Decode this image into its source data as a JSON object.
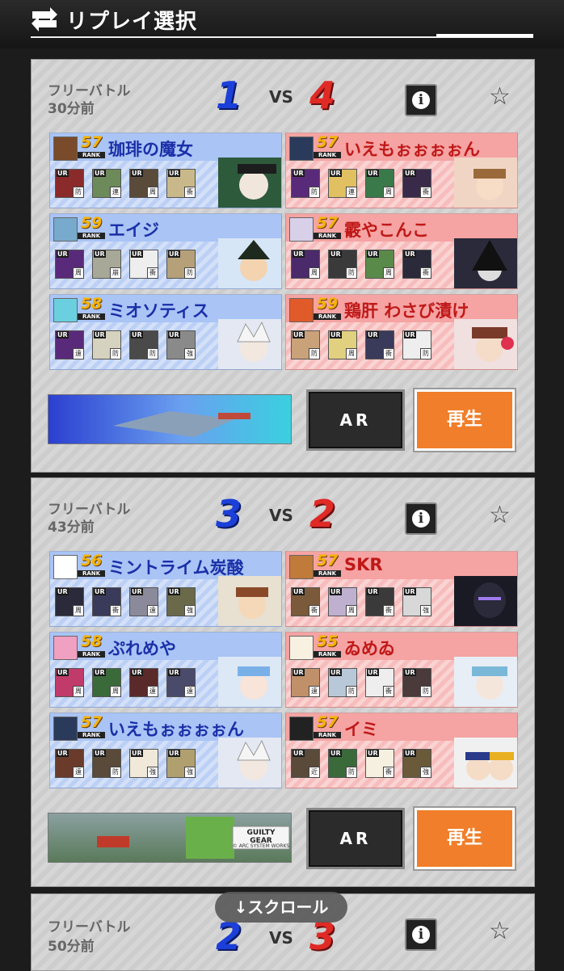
{
  "header": {
    "title": "リプレイ選択",
    "icon": "replay-icon"
  },
  "scroll_hint": "↓スクロール",
  "matches": [
    {
      "mode": "フリーバトル",
      "ago": "30分前",
      "score_left": "1",
      "vs": "VS",
      "score_right": "4",
      "ar_label": "AR",
      "play_label": "再生",
      "team_blue": [
        {
          "name": "珈琲の魔女",
          "rank": "57",
          "rank_label": "RANK",
          "roles": [
            "防",
            "連",
            "周",
            "衝"
          ]
        },
        {
          "name": "エイジ",
          "rank": "59",
          "rank_label": "RANK",
          "roles": [
            "周",
            "崩",
            "衝",
            "防"
          ]
        },
        {
          "name": "ミオソティス",
          "rank": "58",
          "rank_label": "RANK",
          "roles": [
            "遠",
            "防",
            "防",
            "強"
          ]
        }
      ],
      "team_red": [
        {
          "name": "いえもぉぉぉぉん",
          "rank": "57",
          "rank_label": "RANK",
          "roles": [
            "防",
            "連",
            "周",
            "衝"
          ]
        },
        {
          "name": "霰やこんこ",
          "rank": "57",
          "rank_label": "RANK",
          "roles": [
            "周",
            "防",
            "周",
            "衝"
          ]
        },
        {
          "name": "鶏肝 わさび漬け",
          "rank": "59",
          "rank_label": "RANK",
          "roles": [
            "防",
            "周",
            "衝",
            "防"
          ]
        }
      ]
    },
    {
      "mode": "フリーバトル",
      "ago": "43分前",
      "score_left": "3",
      "vs": "VS",
      "score_right": "2",
      "ar_label": "AR",
      "play_label": "再生",
      "stage_logo": "GUILTY GEAR",
      "stage_logo_sub": "© ARC SYSTEM WORKS",
      "team_blue": [
        {
          "name": "ミントライム炭酸",
          "rank": "56",
          "rank_label": "RANK",
          "roles": [
            "周",
            "衝",
            "遠",
            "強"
          ]
        },
        {
          "name": "ぷれめや",
          "rank": "58",
          "rank_label": "RANK",
          "roles": [
            "周",
            "周",
            "遠",
            "遠"
          ]
        },
        {
          "name": "いえもぉぉぉぉん",
          "rank": "57",
          "rank_label": "RANK",
          "roles": [
            "遠",
            "防",
            "強",
            "強"
          ]
        }
      ],
      "team_red": [
        {
          "name": "SKR",
          "rank": "57",
          "rank_label": "RANK",
          "roles": [
            "衝",
            "周",
            "衝",
            "強"
          ]
        },
        {
          "name": "ゐめゐ",
          "rank": "55",
          "rank_label": "RANK",
          "roles": [
            "遠",
            "防",
            "衝",
            "防"
          ]
        },
        {
          "name": "イミ",
          "rank": "57",
          "rank_label": "RANK",
          "roles": [
            "近",
            "防",
            "衝",
            "強"
          ]
        }
      ]
    },
    {
      "mode": "フリーバトル",
      "ago": "50分前",
      "score_left": "2",
      "vs": "VS",
      "score_right": "3"
    }
  ],
  "colors": {
    "blue": "#1b3fd8",
    "red": "#e02a26",
    "play": "#f07e2a"
  }
}
